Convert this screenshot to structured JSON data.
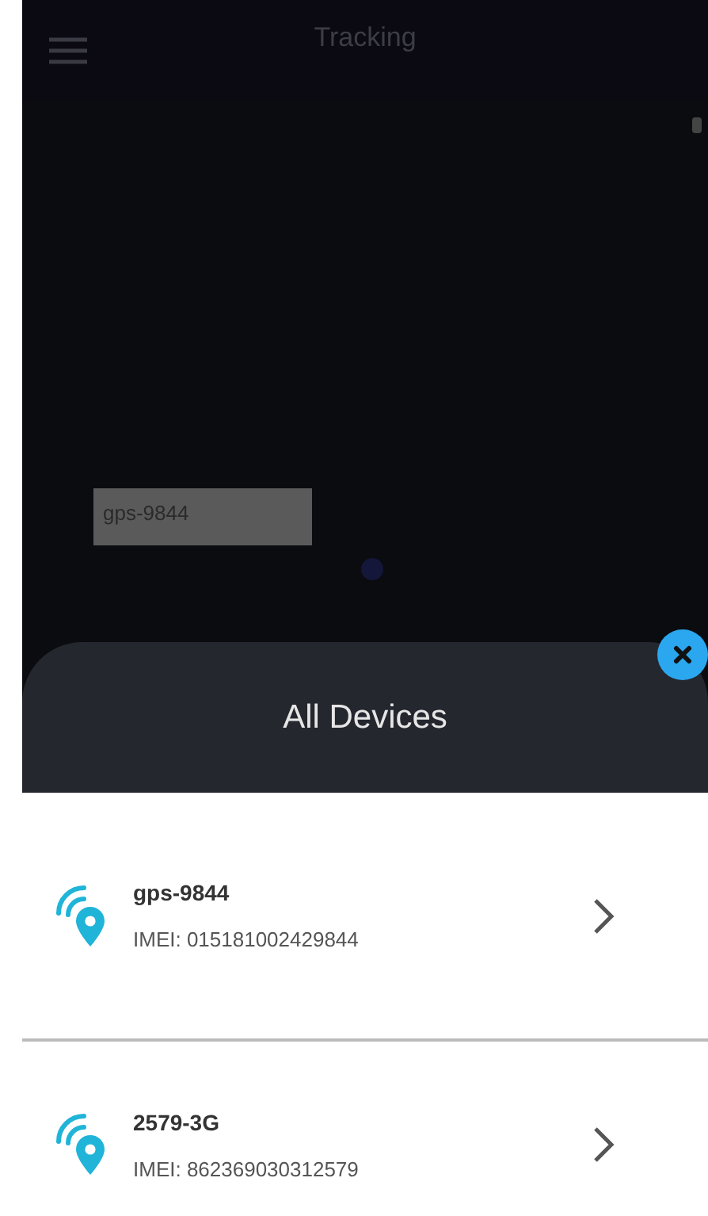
{
  "header": {
    "title": "Tracking"
  },
  "map": {
    "marker_label": "gps-9844"
  },
  "sheet": {
    "title": "All Devices"
  },
  "devices": [
    {
      "name": "gps-9844",
      "imei": "IMEI: 015181002429844"
    },
    {
      "name": "2579-3G",
      "imei": "IMEI: 862369030312579"
    }
  ]
}
